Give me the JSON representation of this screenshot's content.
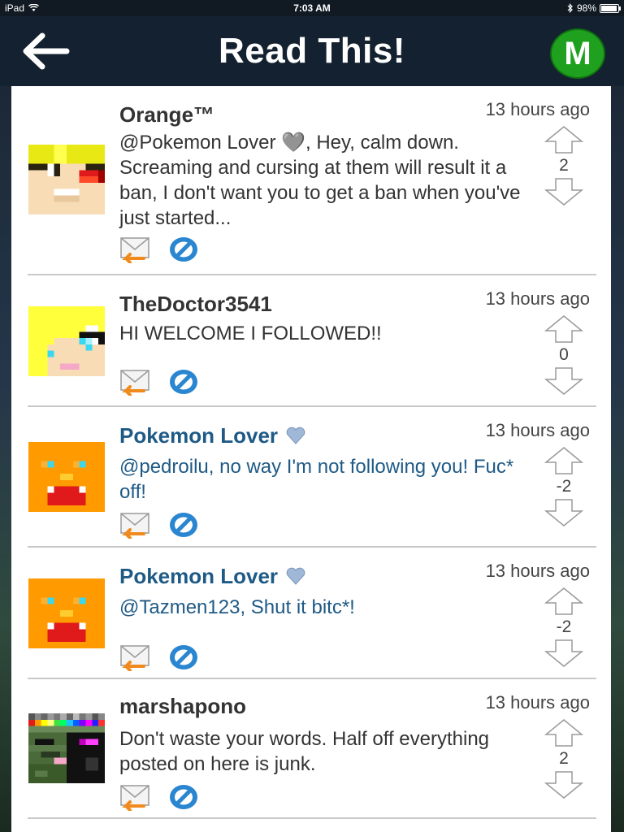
{
  "status": {
    "device": "iPad",
    "time": "7:03 AM",
    "battery": "98%"
  },
  "header": {
    "title": "Read This!",
    "menu_letter": "M"
  },
  "comments": [
    {
      "user": "Orange™",
      "time": "13 hours ago",
      "text": "@Pokemon Lover 🩶, Hey, calm down. Screaming and cursing at them will result it a ban, I don't want you to get a ban when you've just started...",
      "votes": "2",
      "highlight": false
    },
    {
      "user": "TheDoctor3541",
      "time": "13 hours ago",
      "text": "HI WELCOME I FOLLOWED!!",
      "votes": "0",
      "highlight": false
    },
    {
      "user": "Pokemon Lover",
      "time": "13 hours ago",
      "text": "@pedroilu, no way I'm not following you! Fuc* off!",
      "votes": "-2",
      "highlight": true
    },
    {
      "user": "Pokemon Lover",
      "time": "13 hours ago",
      "text": "@Tazmen123, Shut it bitc*!",
      "votes": "-2",
      "highlight": true
    },
    {
      "user": "marshapono",
      "time": "13 hours ago",
      "text": "Don't waste your words. Half off everything posted on here is junk.",
      "votes": "2",
      "highlight": false
    }
  ],
  "icons": {
    "back": "arrow-left-icon",
    "mail": "reply-mail-icon",
    "block": "block-icon",
    "up": "arrow-up-icon",
    "down": "arrow-down-icon",
    "heart": "heart-icon"
  },
  "colors": {
    "header_bg": "#132130",
    "accent_blue": "#1e5a86",
    "menu_green": "#1fa11f",
    "block_blue": "#2a86d0",
    "reply_orange": "#f08a1c"
  }
}
